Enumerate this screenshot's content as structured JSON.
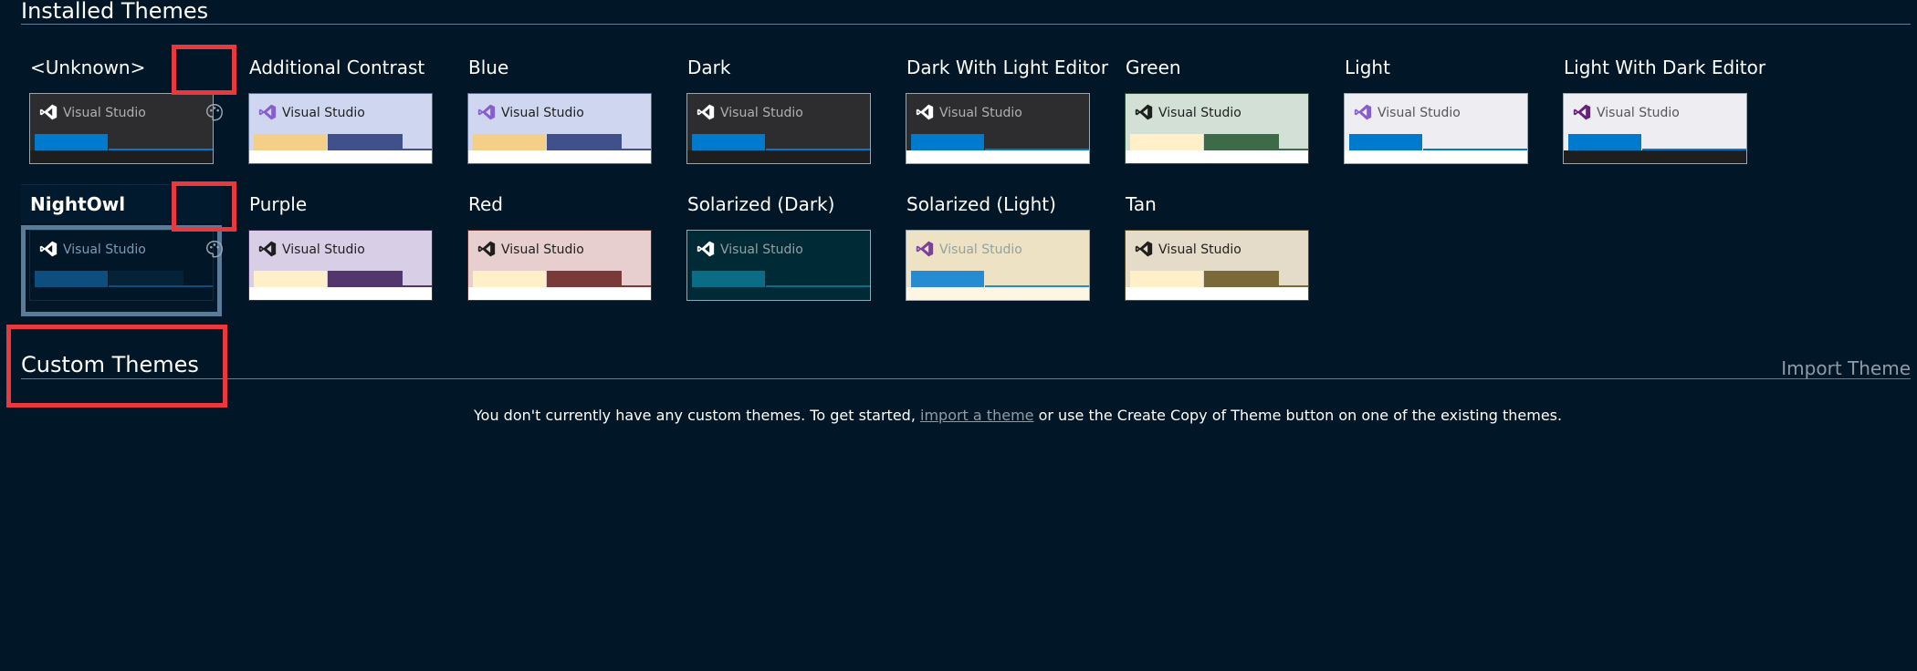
{
  "installed": {
    "title": "Installed Themes",
    "themes": [
      {
        "name": "<Unknown>",
        "bg": "#2d2d30",
        "text": "#b0b0b0",
        "logo": "#ffffff",
        "b1": "#007acc",
        "b2": "#2d2d30",
        "b3": "#1e1e1e",
        "line": "#007acc",
        "preview_border": "#9aa4ad",
        "icon": "palette-icon"
      },
      {
        "name": "Additional Contrast",
        "bg": "#cfd7f0",
        "text": "#1e1e1e",
        "logo": "#8a5cd1",
        "b1": "#f5cf87",
        "b2": "#40508a",
        "b3": "#ffffff",
        "line": "#40508a",
        "preview_border": "#5a6a8a"
      },
      {
        "name": "Blue",
        "bg": "#cfd7f0",
        "text": "#1e1e1e",
        "logo": "#8a5cd1",
        "b1": "#f5cf87",
        "b2": "#40508a",
        "b3": "#ffffff",
        "line": "#40508a",
        "preview_border": "#5a6a8a"
      },
      {
        "name": "Dark",
        "bg": "#2d2d30",
        "text": "#b0b0b0",
        "logo": "#ffffff",
        "b1": "#007acc",
        "b2": "#2d2d30",
        "b3": "#1e1e1e",
        "line": "#007acc",
        "preview_border": "#9aa4ad"
      },
      {
        "name": "Dark With Light Editor",
        "bg": "#2d2d30",
        "text": "#b0b0b0",
        "logo": "#ffffff",
        "b1": "#007acc",
        "b2": "#2d2d30",
        "b3": "#ffffff",
        "line": "#007acc",
        "preview_border": "#9aa4ad"
      },
      {
        "name": "Green",
        "bg": "#d3e0d5",
        "text": "#1e1e1e",
        "logo": "#1e1e1e",
        "b1": "#fff0c9",
        "b2": "#3d6b47",
        "b3": "#ffffff",
        "line": "#3d6b47",
        "preview_border": "#2f5236"
      },
      {
        "name": "Light",
        "bg": "#eeeef2",
        "text": "#555555",
        "logo": "#8a5cd1",
        "b1": "#007acc",
        "b2": "#eeeef2",
        "b3": "#ffffff",
        "line": "#007acc",
        "preview_border": "#9aa4ad"
      },
      {
        "name": "Light With Dark Editor",
        "bg": "#eeeef2",
        "text": "#555555",
        "logo": "#68217a",
        "b1": "#007acc",
        "b2": "#eeeef2",
        "b3": "#1e1e1e",
        "line": "#007acc",
        "preview_border": "#9aa4ad"
      },
      {
        "name": "NightOwl",
        "bg": "#011627",
        "text": "#7a9bb5",
        "logo": "#ffffff",
        "b1": "#0e4e7f",
        "b2": "#062238",
        "b3": "#011627",
        "line": "#0e4e7f",
        "preview_border": "#122d42",
        "icon": "palette-icon",
        "selected": true
      },
      {
        "name": "Purple",
        "bg": "#d8cfe6",
        "text": "#1e1e1e",
        "logo": "#1e1e1e",
        "b1": "#fff0c9",
        "b2": "#51376e",
        "b3": "#ffffff",
        "line": "#51376e",
        "preview_border": "#3a2a58"
      },
      {
        "name": "Red",
        "bg": "#e7cfcf",
        "text": "#1e1e1e",
        "logo": "#1e1e1e",
        "b1": "#fff0c9",
        "b2": "#7a3a3a",
        "b3": "#ffffff",
        "line": "#7a3a3a",
        "preview_border": "#5a2a2a"
      },
      {
        "name": "Solarized (Dark)",
        "bg": "#002b36",
        "text": "#93a1a1",
        "logo": "#ffffff",
        "b1": "#0a6d85",
        "b2": "#002b36",
        "b3": "#002b36",
        "line": "#0a6d85",
        "preview_border": "#9aa4ad"
      },
      {
        "name": "Solarized (Light)",
        "bg": "#ede2c3",
        "text": "#93a1a1",
        "logo": "#7b3fa0",
        "b1": "#268bd2",
        "b2": "#ede2c3",
        "b3": "#fdf6e3",
        "line": "#268bd2",
        "preview_border": "#9aa4ad"
      },
      {
        "name": "Tan",
        "bg": "#e4dcc8",
        "text": "#1e1e1e",
        "logo": "#1e1e1e",
        "b1": "#fff0c9",
        "b2": "#7a6a3a",
        "b3": "#ffffff",
        "line": "#7a6a3a",
        "preview_border": "#5a4e2a"
      }
    ]
  },
  "custom": {
    "title": "Custom Themes",
    "import_label": "Import Theme",
    "empty_before": "You don't currently have any custom themes. To get started, ",
    "empty_link": "import a theme",
    "empty_after": " or use the Create Copy of Theme button on one of the existing themes."
  },
  "preview_label": "Visual Studio",
  "colors": {
    "page_bg": "#011627",
    "highlight": "#e9393e",
    "link": "#8f9ba5",
    "selected_border": "#5a7c99"
  }
}
